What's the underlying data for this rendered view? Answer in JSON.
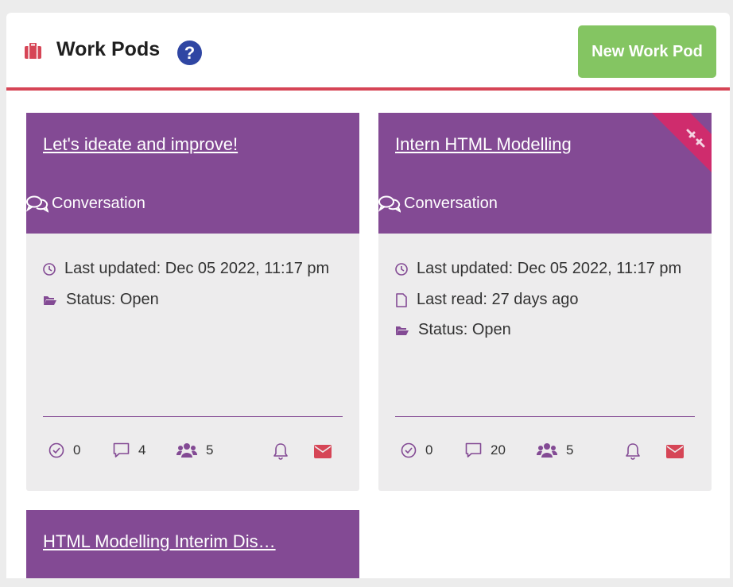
{
  "header": {
    "title": "Work Pods",
    "help_label": "?",
    "new_button_label": "New Work Pod"
  },
  "colors": {
    "accent_red": "#d64556",
    "card_purple": "#834a94",
    "button_green": "#84c562",
    "help_blue": "#2f46a3",
    "pin_ribbon": "#cf2c6d"
  },
  "cards": [
    {
      "title": "Let's ideate and improve!",
      "type": "Conversation",
      "last_updated": "Last updated: Dec 05 2022, 11:17 pm",
      "status": "Status: Open",
      "tasks": "0",
      "comments": "4",
      "members": "5"
    },
    {
      "title": "Intern HTML Modelling",
      "type": "Conversation",
      "last_updated": "Last updated: Dec 05 2022, 11:17 pm",
      "last_read": "Last read: 27 days ago",
      "status": "Status: Open",
      "tasks": "0",
      "comments": "20",
      "members": "5",
      "pinned": true
    },
    {
      "title": "HTML Modelling Interim Dis…"
    }
  ]
}
